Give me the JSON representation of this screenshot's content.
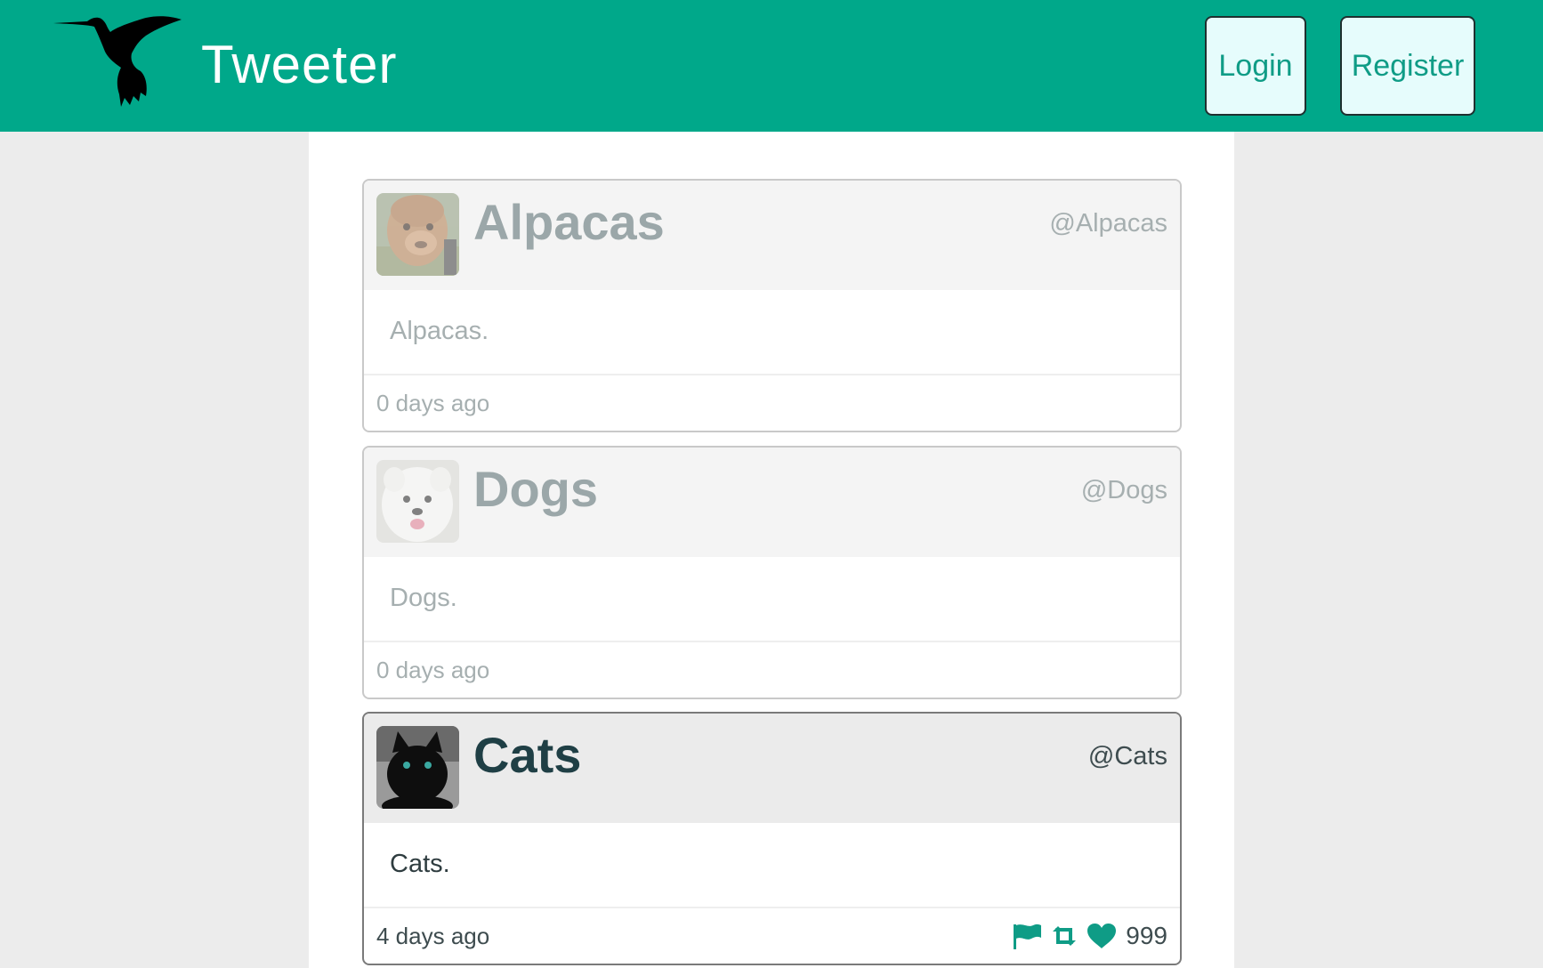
{
  "header": {
    "title": "Tweeter",
    "login_label": "Login",
    "register_label": "Register",
    "logo_icon": "hummingbird-icon"
  },
  "colors": {
    "brand": "#00a88a",
    "button_bg": "#e6fcfc",
    "icon_accent": "#0f9c86"
  },
  "tweets": [
    {
      "name": "Alpacas",
      "handle": "@Alpacas",
      "text": "Alpacas.",
      "time": "0 days ago",
      "avatar_icon": "alpaca-avatar"
    },
    {
      "name": "Dogs",
      "handle": "@Dogs",
      "text": "Dogs.",
      "time": "0 days ago",
      "avatar_icon": "dog-avatar"
    },
    {
      "name": "Cats",
      "handle": "@Cats",
      "text": "Cats.",
      "time": "4 days ago",
      "avatar_icon": "cat-avatar",
      "likes": "999",
      "action_icons": [
        "flag-icon",
        "retweet-icon",
        "heart-icon"
      ]
    }
  ]
}
